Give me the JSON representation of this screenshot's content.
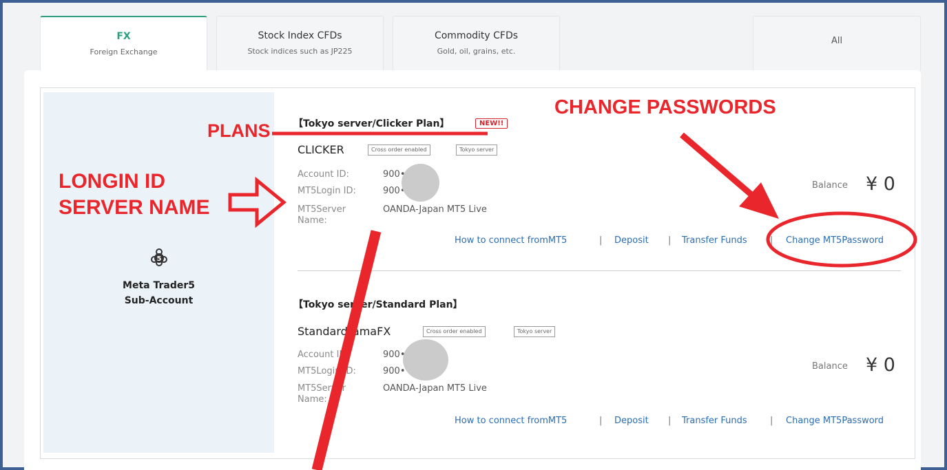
{
  "tabs": [
    {
      "title": "FX",
      "subtitle": "Foreign Exchange"
    },
    {
      "title": "Stock Index CFDs",
      "subtitle": "Stock indices such as JP225"
    },
    {
      "title": "Commodity CFDs",
      "subtitle": "Gold, oil, grains, etc."
    },
    {
      "title": "All"
    }
  ],
  "sidebar": {
    "line1": "Meta Trader5",
    "line2": "Sub-Account",
    "icon_number": "5"
  },
  "accounts": [
    {
      "plan": "【Tokyo server/Clicker Plan】",
      "badge": "NEW!!",
      "name": "CLICKER",
      "tags": [
        "Cross order enabled",
        "Tokyo server"
      ],
      "account_id_label": "Account ID:",
      "account_id": "900•••••4",
      "login_id_label": "MT5Login ID:",
      "login_id": "900•••••4",
      "server_label_1": "MT5Server",
      "server_label_2": "Name:",
      "server_name": "OANDA-Japan MT5 Live",
      "balance_label": "Balance",
      "balance": "¥ 0",
      "links": [
        "How to connect fromMT5",
        "Deposit",
        "Transfer Funds",
        "Change MT5Password"
      ]
    },
    {
      "plan": "【Tokyo server/Standard Plan】",
      "name": "StandardTamaFX",
      "tags": [
        "Cross order enabled",
        "Tokyo server"
      ],
      "account_id_label": "Account ID:",
      "account_id": "900•••••",
      "login_id_label": "MT5Login ID:",
      "login_id": "900•••••",
      "server_label_1": "MT5Server",
      "server_label_2": "Name:",
      "server_name": "OANDA-Japan MT5 Live",
      "balance_label": "Balance",
      "balance": "¥ 0",
      "links": [
        "How to connect fromMT5",
        "Deposit",
        "Transfer Funds",
        "Change MT5Password"
      ]
    }
  ],
  "separator": "|",
  "annotations": {
    "plans": "PLANS",
    "change_passwords": "CHANGE PASSWORDS",
    "login_line1": "LONGIN ID",
    "login_line2": "SERVER NAME"
  },
  "colors": {
    "accent": "#2b9f7f",
    "link": "#2a6db5",
    "annotation": "#e8262b",
    "frame": "#3d5f93"
  }
}
